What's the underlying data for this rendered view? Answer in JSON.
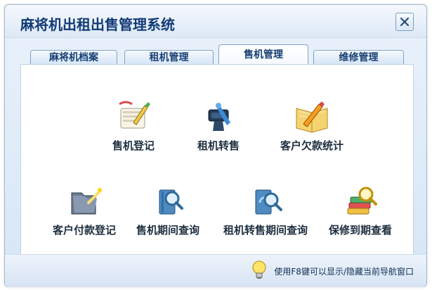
{
  "window": {
    "title": "麻将机出租出售管理系统"
  },
  "tabs": [
    {
      "label": "麻将机档案"
    },
    {
      "label": "租机管理"
    },
    {
      "label": "售机管理",
      "active": true
    },
    {
      "label": "维修管理"
    }
  ],
  "items": [
    {
      "label": "售机登记",
      "icon": "notepad-pencil-icon"
    },
    {
      "label": "租机转售",
      "icon": "screwdriver-toolbox-icon"
    },
    {
      "label": "客户欠款统计",
      "icon": "open-book-pencil-icon"
    },
    {
      "label": "客户付款登记",
      "icon": "folder-wand-icon"
    },
    {
      "label": "售机期间查询",
      "icon": "book-magnifier-icon"
    },
    {
      "label": "租机转售期间查询",
      "icon": "book-refresh-magnifier-icon"
    },
    {
      "label": "保修到期查看",
      "icon": "book-stack-magnifier-icon"
    }
  ],
  "footer": {
    "hint": "使用F8键可以显示/隐藏当前导航窗口"
  }
}
